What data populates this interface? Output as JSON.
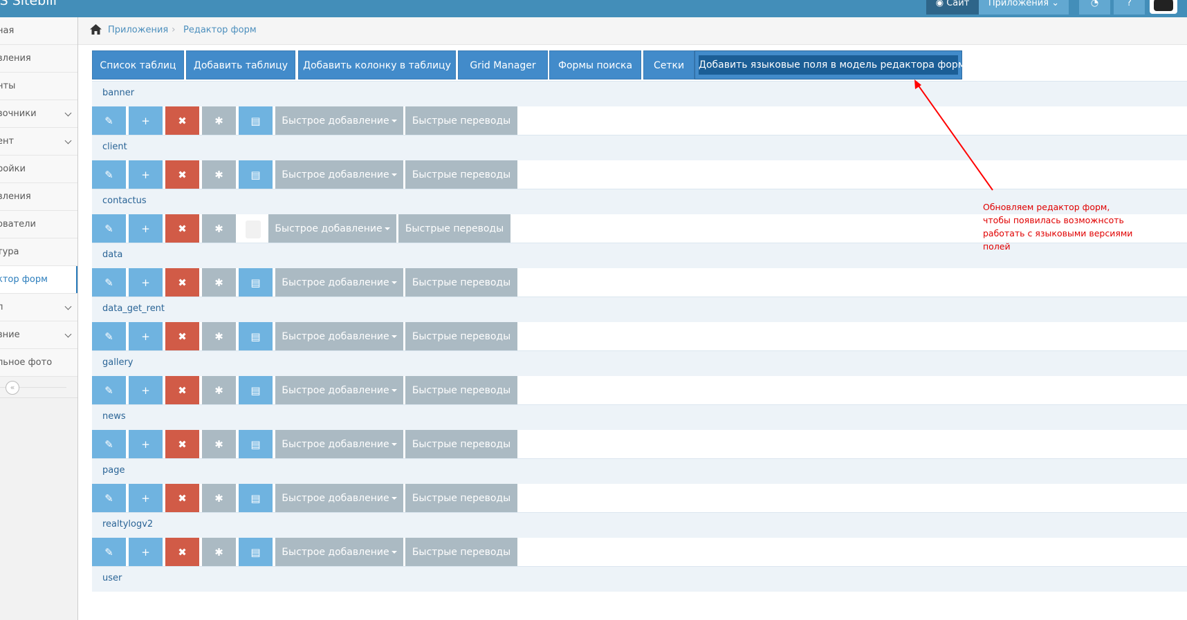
{
  "navbar": {
    "brand": "IS Sitebill",
    "site_label": "Сайт",
    "apps_label": "Приложения"
  },
  "sidebar": {
    "items": [
      {
        "label": "ная",
        "has_submenu": false
      },
      {
        "label": "вления",
        "has_submenu": false
      },
      {
        "label": "нты",
        "has_submenu": false
      },
      {
        "label": "вочники",
        "has_submenu": true
      },
      {
        "label": "ент",
        "has_submenu": true
      },
      {
        "label": "ройки",
        "has_submenu": false
      },
      {
        "label": "вления",
        "has_submenu": false
      },
      {
        "label": "ователи",
        "has_submenu": false
      },
      {
        "label": "тура",
        "has_submenu": false
      },
      {
        "label": "ктор форм",
        "has_submenu": false,
        "active": true
      },
      {
        "label": "п",
        "has_submenu": true
      },
      {
        "label": "вние",
        "has_submenu": true
      },
      {
        "label": "льное фото",
        "has_submenu": false
      }
    ],
    "collapse_glyph": "«"
  },
  "breadcrumbs": {
    "apps": "Приложения",
    "current": "Редактор форм"
  },
  "tabs": {
    "list_tables": "Список таблиц",
    "add_table": "Добавить таблицу",
    "add_column": "Добавить колонку в таблицу",
    "grid_manager": "Grid Manager",
    "search_forms": "Формы поиска",
    "grids": "Сетки",
    "add_lang_fields": "Добавить языковые поля в модель редактора форм"
  },
  "actions": {
    "quick_add": "Быстрое добавление",
    "quick_translate": "Быстрые переводы",
    "icons": [
      "pencil-icon",
      "plus-icon",
      "remove-icon",
      "asterisk-icon",
      "list-icon"
    ]
  },
  "tables": [
    {
      "name": "banner"
    },
    {
      "name": "client"
    },
    {
      "name": "contactus"
    },
    {
      "name": "data"
    },
    {
      "name": "data_get_rent"
    },
    {
      "name": "gallery"
    },
    {
      "name": "news"
    },
    {
      "name": "page"
    },
    {
      "name": "realtylogv2"
    },
    {
      "name": "user"
    }
  ],
  "annotation": {
    "lines": [
      "Обновляем редактор форм,",
      "чтобы появилась возможнсоть",
      "работать с языковыми версиями",
      "полей"
    ],
    "color": "#e00000"
  },
  "colors": {
    "navbar": "#438eb9",
    "primary_button": "#428bca",
    "light_blue_button": "#6fb3e0",
    "danger_button": "#d15b47",
    "grey_button": "#abbac3"
  }
}
